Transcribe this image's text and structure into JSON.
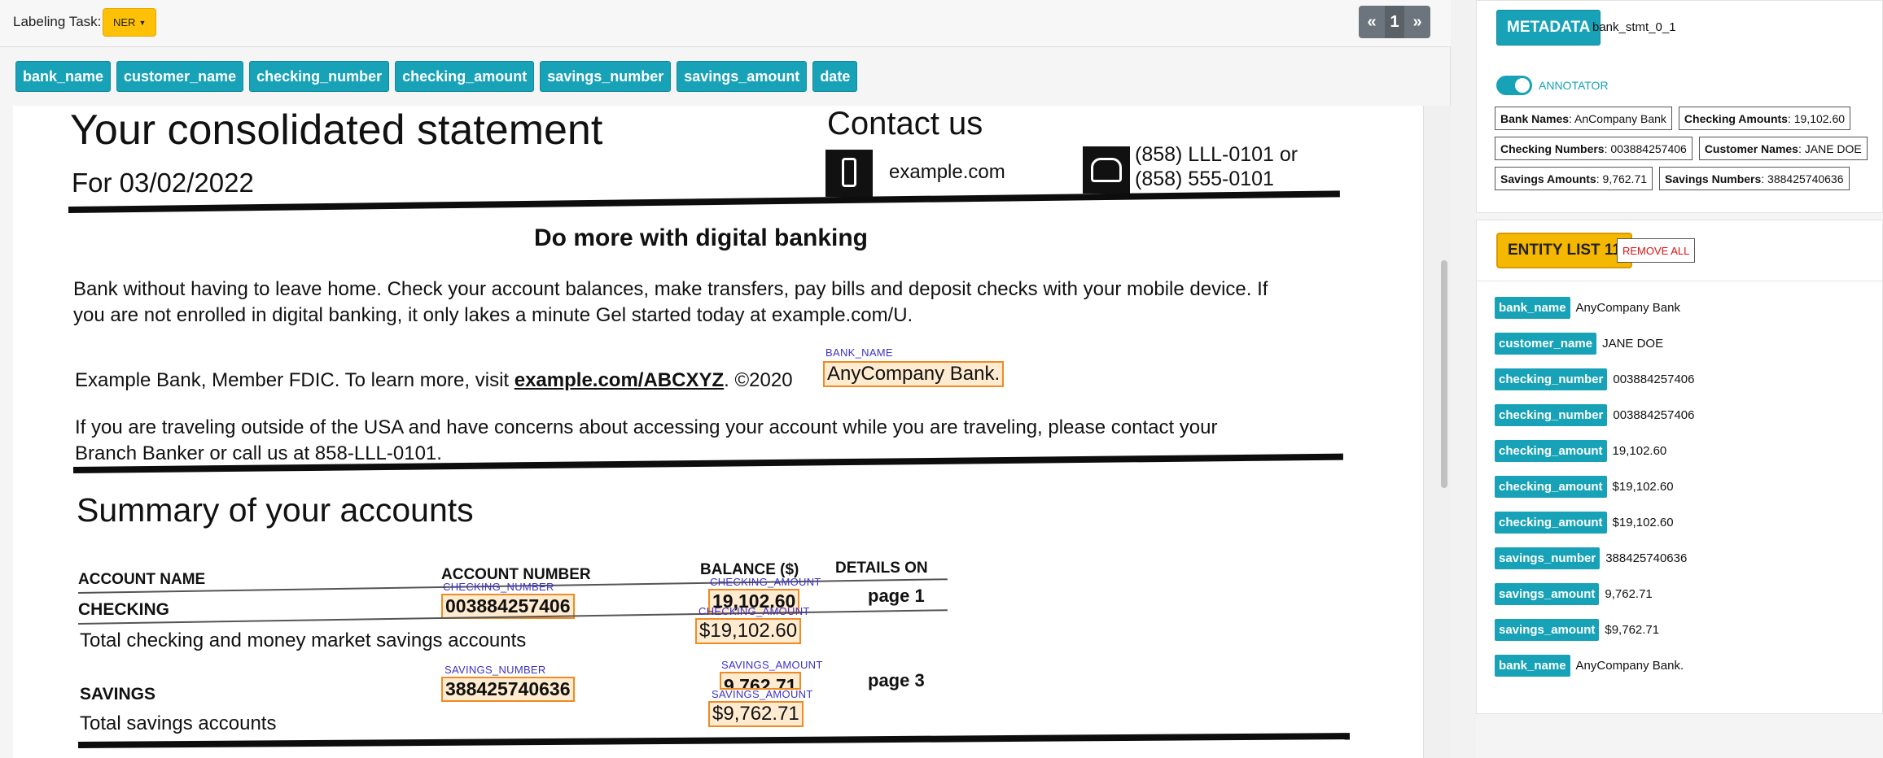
{
  "header": {
    "task_label": "Labeling Task:",
    "task_value": "NER",
    "pager": {
      "prev": "«",
      "page": "1",
      "next": "»"
    }
  },
  "labels": [
    "bank_name",
    "customer_name",
    "checking_number",
    "checking_amount",
    "savings_number",
    "savings_amount",
    "date"
  ],
  "document": {
    "title": "Your consolidated statement",
    "date_line": "For 03/02/2022",
    "contact_title": "Contact us",
    "contact_web": "example.com",
    "phone_1": "(858) LLL-0101 or",
    "phone_2": "(858) 555-0101",
    "digital_heading": "Do more with digital banking",
    "para1_line1": "Bank without having to leave home. Check your account balances, make transfers, pay bills and deposit checks with your mobile device. If",
    "para1_line2": "you are not enrolled in digital banking, it only lakes a minute Gel started today at example.com/U.",
    "fdic_text": "Example Bank, Member FDIC. To learn more, visit",
    "fdic_link": "example.com/ABCXYZ",
    "fdic_copy": ". ©2020",
    "bank_name": "AnyCompany Bank.",
    "travel_line1": "If you are traveling outside of the USA and have concerns about accessing your account while you are traveling, please contact your",
    "travel_line2": "Branch Banker or call us at 858-LLL-0101.",
    "summary_title": "Summary of your accounts",
    "col_account_name": "ACCOUNT NAME",
    "col_account_number": "ACCOUNT NUMBER",
    "col_balance": "BALANCE ($)",
    "col_details": "DETAILS ON",
    "checking_label": "CHECKING",
    "checking_number": "003884257406",
    "checking_balance": "19,102.60",
    "checking_details": "page 1",
    "checking_total_label": "Total checking and money market savings accounts",
    "checking_total": "$19,102.60",
    "savings_label": "SAVINGS",
    "savings_number": "388425740636",
    "savings_balance": "9,762.71",
    "savings_details": "page 3",
    "savings_total_label": "Total savings accounts",
    "savings_total": "$9,762.71",
    "tags": {
      "bank_name": "BANK_NAME",
      "checking_number": "CHECKING_NUMBER",
      "checking_amount": "CHECKING_AMOUNT",
      "savings_number": "SAVINGS_NUMBER",
      "savings_amount": "SAVINGS_AMOUNT"
    }
  },
  "metadata": {
    "button": "METADATA",
    "doc_id": "bank_stmt_0_1",
    "toggle_label": "ANNOTATOR",
    "toggle_on": true,
    "summary": [
      {
        "key": "Bank Names",
        "value": ": AnCompany Bank"
      },
      {
        "key": "Checking Amounts",
        "value": ": 19,102.60"
      },
      {
        "key": "Checking Numbers",
        "value": ": 003884257406"
      },
      {
        "key": "Customer Names",
        "value": ": JANE DOE"
      },
      {
        "key": "Savings Amounts",
        "value": ": 9,762.71"
      },
      {
        "key": "Savings Numbers",
        "value": ": 388425740636"
      }
    ]
  },
  "entities": {
    "header": "ENTITY LIST 11",
    "remove_all": "REMOVE ALL",
    "items": [
      {
        "tag": "bank_name",
        "value": "AnyCompany Bank"
      },
      {
        "tag": "customer_name",
        "value": "JANE DOE"
      },
      {
        "tag": "checking_number",
        "value": "003884257406"
      },
      {
        "tag": "checking_number",
        "value": "003884257406"
      },
      {
        "tag": "checking_amount",
        "value": "19,102.60"
      },
      {
        "tag": "checking_amount",
        "value": "$19,102.60"
      },
      {
        "tag": "checking_amount",
        "value": "$19,102.60"
      },
      {
        "tag": "savings_number",
        "value": "388425740636"
      },
      {
        "tag": "savings_amount",
        "value": "9,762.71"
      },
      {
        "tag": "savings_amount",
        "value": "$9,762.71"
      },
      {
        "tag": "bank_name",
        "value": "AnyCompany Bank."
      }
    ]
  },
  "colors": {
    "accent": "#17a2b8",
    "warning": "#ffc107",
    "highlight_border": "#f08a24",
    "tag_text": "#3b33c8",
    "danger": "#dd1111"
  }
}
